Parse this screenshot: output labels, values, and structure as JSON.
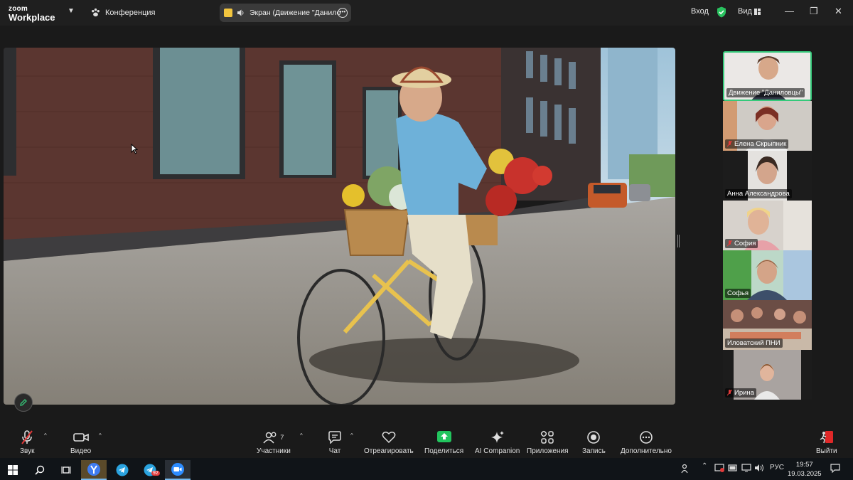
{
  "app": {
    "logo_line1": "zoom",
    "logo_line2": "Workplace",
    "meeting_label": "Конференция"
  },
  "share_pill": {
    "text": "Экран (Движение \"Данило"
  },
  "top_right": {
    "signin": "Вход",
    "view": "Вид"
  },
  "participants": [
    {
      "name": "Движение \"Даниловцы\"",
      "muted": false,
      "active": true
    },
    {
      "name": "Елена Скрыпник",
      "muted": true,
      "active": false
    },
    {
      "name": "Анна Александрова",
      "muted": false,
      "active": false
    },
    {
      "name": "София",
      "muted": true,
      "active": false
    },
    {
      "name": "Софья",
      "muted": false,
      "active": false
    },
    {
      "name": "Иловатский ПНИ",
      "muted": false,
      "active": false
    },
    {
      "name": "Ирина",
      "muted": true,
      "active": false
    }
  ],
  "toolbar": {
    "audio": "Звук",
    "video": "Видео",
    "participants": "Участники",
    "participants_count": "7",
    "chat": "Чат",
    "react": "Отреагировать",
    "share": "Поделиться",
    "ai": "AI Companion",
    "apps": "Приложения",
    "record": "Запись",
    "more": "Дополнительно",
    "leave": "Выйти"
  },
  "taskbar": {
    "lang": "РУС",
    "time": "19:57",
    "date": "19.03.2025",
    "telegram_badge": "92"
  },
  "colors": {
    "accent_green": "#35c97a",
    "share_green": "#22c55e",
    "leave_red": "#e02828"
  }
}
